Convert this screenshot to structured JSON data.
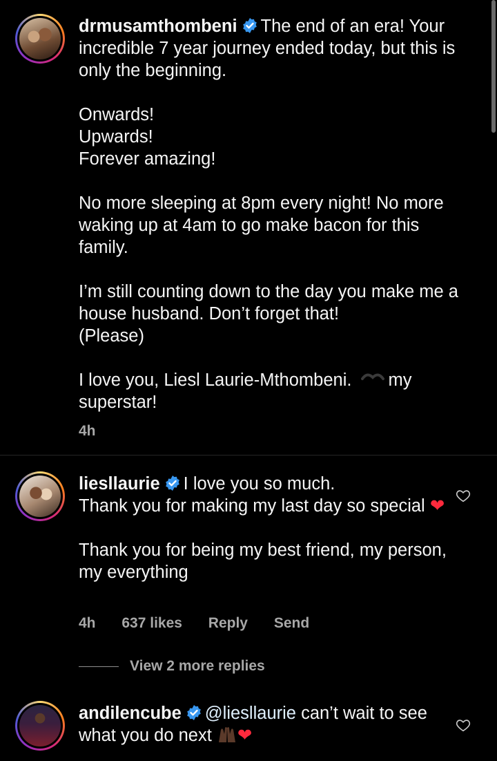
{
  "post": {
    "username": "drmusamthombeni",
    "paragraphs": [
      "The end of an era! Your incredible 7 year journey ended today, but this is only the beginning.",
      "Onwards!",
      "Upwards!",
      "Forever amazing!",
      "No more sleeping at 8pm every night! No more waking up at 4am to go make bacon for this family.",
      "I’m still counting down to the day you make me a house husband. Don’t forget that!",
      "(Please)",
      "I love you, Liesl Laurie-Mthombeni.",
      "my superstar!"
    ],
    "time": "4h"
  },
  "comments": [
    {
      "username": "liesllaurie",
      "text_lines": [
        "I love you so much.",
        "Thank you for making my last day so special"
      ],
      "text_2": "Thank you for being my best friend, my person, my everything",
      "time": "4h",
      "likes": "637 likes",
      "reply_label": "Reply",
      "send_label": "Send"
    },
    {
      "username": "andilencube",
      "mention": "@liesllaurie",
      "text": "can’t wait to see what you do next"
    }
  ],
  "view_more_replies": "View 2 more replies",
  "colors": {
    "verified": "#3897f0",
    "heart_emoji": "#ff2a3d",
    "meta": "#a8a8a8"
  }
}
